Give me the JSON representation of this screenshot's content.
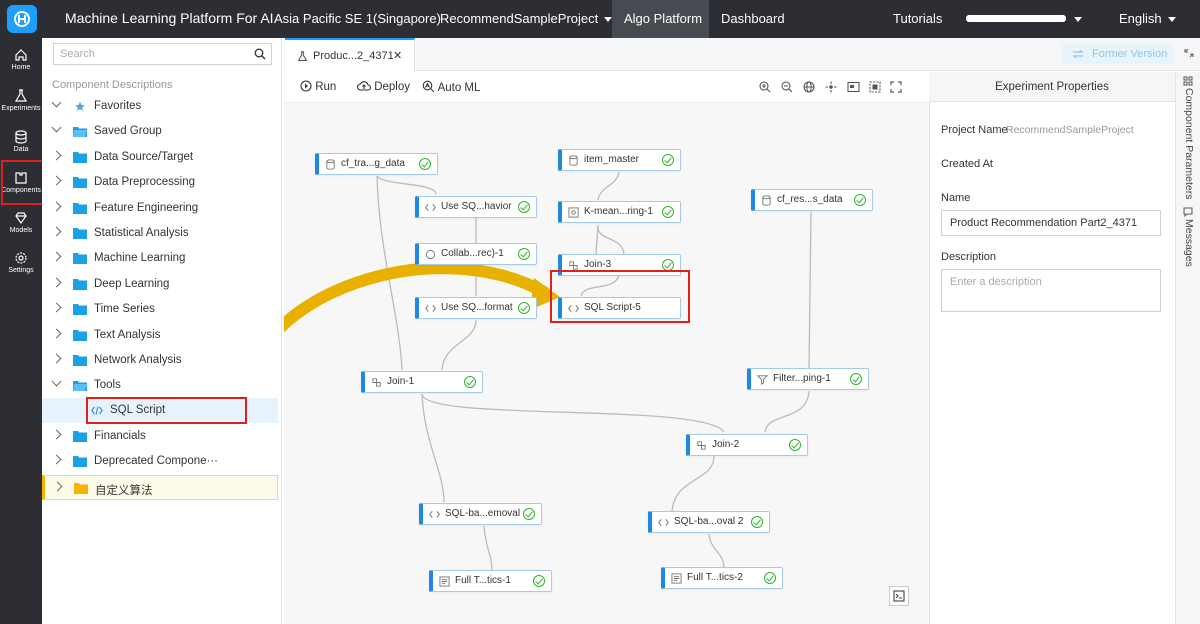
{
  "topbar": {
    "title": "Machine Learning Platform For AI",
    "region": "Asia Pacific SE 1(Singapore)",
    "project": "RecommendSampleProject",
    "algo": "Algo Platform",
    "dashboard": "Dashboard",
    "tutorials": "Tutorials",
    "language": "English"
  },
  "leftnav": [
    {
      "label": "Home",
      "icon": "home-icon"
    },
    {
      "label": "Experiments",
      "icon": "flask-icon"
    },
    {
      "label": "Data",
      "icon": "database-icon"
    },
    {
      "label": "Components",
      "icon": "puzzle-icon"
    },
    {
      "label": "Models",
      "icon": "diamond-icon"
    },
    {
      "label": "Settings",
      "icon": "gear-icon"
    }
  ],
  "components": {
    "search_placeholder": "Search",
    "heading": "Component Descriptions",
    "items": [
      "Favorites",
      "Saved Group",
      "Data Source/Target",
      "Data Preprocessing",
      "Feature Engineering",
      "Statistical Analysis",
      "Machine Learning",
      "Deep Learning",
      "Time Series",
      "Text Analysis",
      "Network Analysis",
      "Tools",
      "SQL Script",
      "Financials",
      "Deprecated Compone···",
      "自定义算法"
    ]
  },
  "tab": {
    "label": "Produc...2_4371",
    "close": "✕"
  },
  "former_version": "Former Version",
  "toolbar": {
    "run": "Run",
    "deploy": "Deploy",
    "automl": "Auto ML"
  },
  "nodes": [
    "cf_tra...g_data",
    "Use SQ...havior",
    "Collab...rec)-1",
    "Use SQ...format",
    "item_master",
    "K-mean...ring-1",
    "Join-3",
    "SQL Script-5",
    "cf_res...s_data",
    "Join-1",
    "Filter...ping-1",
    "Join-2",
    "SQL-ba...emoval",
    "SQL-ba...oval 2",
    "Full T...tics-1",
    "Full T...tics-2"
  ],
  "properties": {
    "title": "Experiment Properties",
    "project_label": "Project Name",
    "project_value": "RecommendSampleProject",
    "created_label": "Created At",
    "name_label": "Name",
    "name_value": "Product Recommendation Part2_4371",
    "desc_label": "Description",
    "desc_placeholder": "Enter a description"
  },
  "side_tabs": {
    "params": "Component Parameters",
    "messages": "Messages"
  },
  "colors": {
    "accent": "#1e9fff",
    "topbar": "#2c2e33",
    "highlight": "#e0201b",
    "arrow": "#e8b100",
    "ok": "#2db52d"
  }
}
